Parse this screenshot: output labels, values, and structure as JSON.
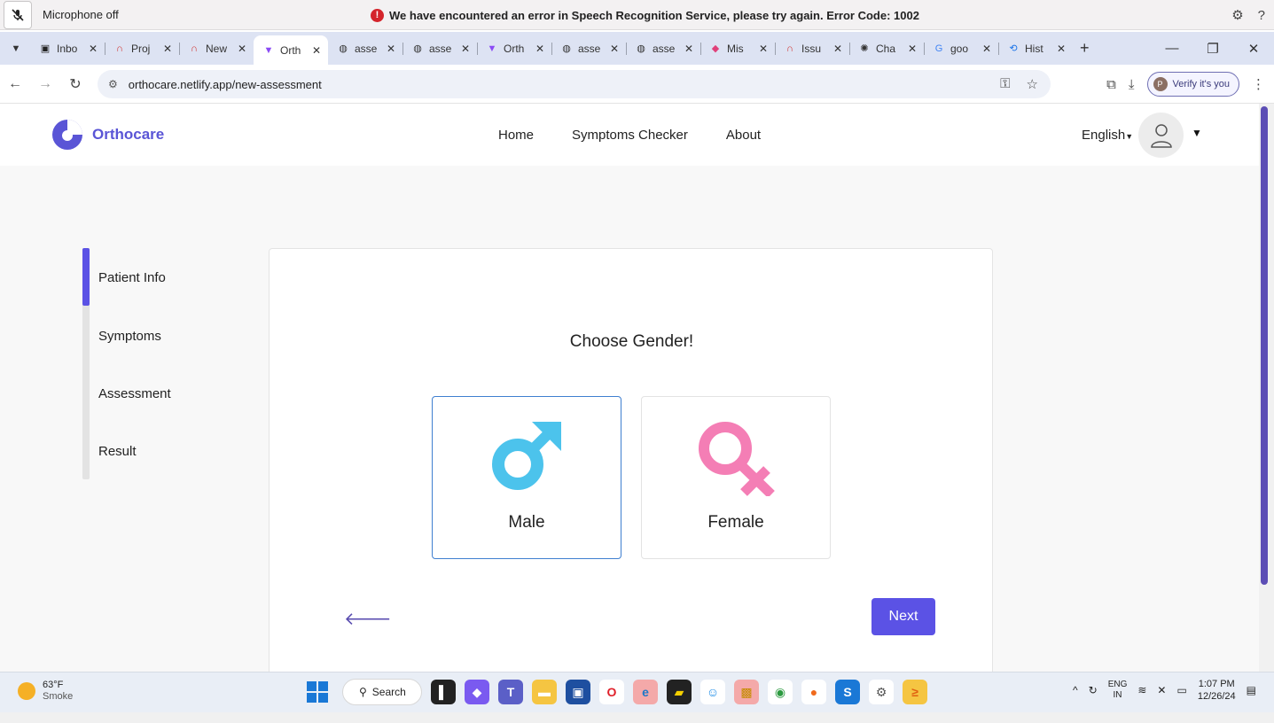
{
  "notification": {
    "mic_label": "Microphone off",
    "error_message": "We have encountered an error in Speech Recognition Service, please try again. Error Code: 1002"
  },
  "tabs": [
    {
      "label": "Inbo",
      "icon": "inbox-icon",
      "color": "#222222"
    },
    {
      "label": "Proj",
      "icon": "arc-icon",
      "color": "#d0312d"
    },
    {
      "label": "New",
      "icon": "arc-icon",
      "color": "#d0312d"
    },
    {
      "label": "Orth",
      "icon": "vite-icon",
      "color": "#8b4bf5",
      "active": true
    },
    {
      "label": "asse",
      "icon": "globe-icon",
      "color": "#333333"
    },
    {
      "label": "asse",
      "icon": "globe-icon",
      "color": "#333333"
    },
    {
      "label": "Orth",
      "icon": "vite-icon",
      "color": "#8b4bf5"
    },
    {
      "label": "asse",
      "icon": "globe-icon",
      "color": "#333333"
    },
    {
      "label": "asse",
      "icon": "globe-icon",
      "color": "#333333"
    },
    {
      "label": "Mis",
      "icon": "diamond-icon",
      "color": "#e0407a"
    },
    {
      "label": "Issu",
      "icon": "arc-icon",
      "color": "#d0312d"
    },
    {
      "label": "Cha",
      "icon": "chatgpt-icon",
      "color": "#333333"
    },
    {
      "label": "goo",
      "icon": "google-icon",
      "color": "#4285f4"
    },
    {
      "label": "Hist",
      "icon": "history-icon",
      "color": "#1a73e8"
    }
  ],
  "address_bar": {
    "url": "orthocare.netlify.app/new-assessment",
    "profile_label": "Verify it's you",
    "profile_initial": "P"
  },
  "site": {
    "brand": "Orthocare",
    "brand_color": "#5a55d6",
    "nav": [
      "Home",
      "Symptoms Checker",
      "About"
    ],
    "language": "English"
  },
  "steps": [
    "Patient Info",
    "Symptoms",
    "Assessment",
    "Result"
  ],
  "active_step": 0,
  "assessment": {
    "title": "Choose Gender!",
    "options": [
      {
        "label": "Male",
        "icon": "male-symbol-icon",
        "color": "#4cc3ec",
        "selected": true
      },
      {
        "label": "Female",
        "icon": "female-symbol-icon",
        "color": "#f47eb5",
        "selected": false
      }
    ],
    "next_label": "Next",
    "accent_color": "#5b52e5"
  },
  "taskbar": {
    "temperature": "63°F",
    "condition": "Smoke",
    "search_label": "Search",
    "lang_top": "ENG",
    "lang_bottom": "IN",
    "time": "1:07 PM",
    "date": "12/26/24"
  }
}
